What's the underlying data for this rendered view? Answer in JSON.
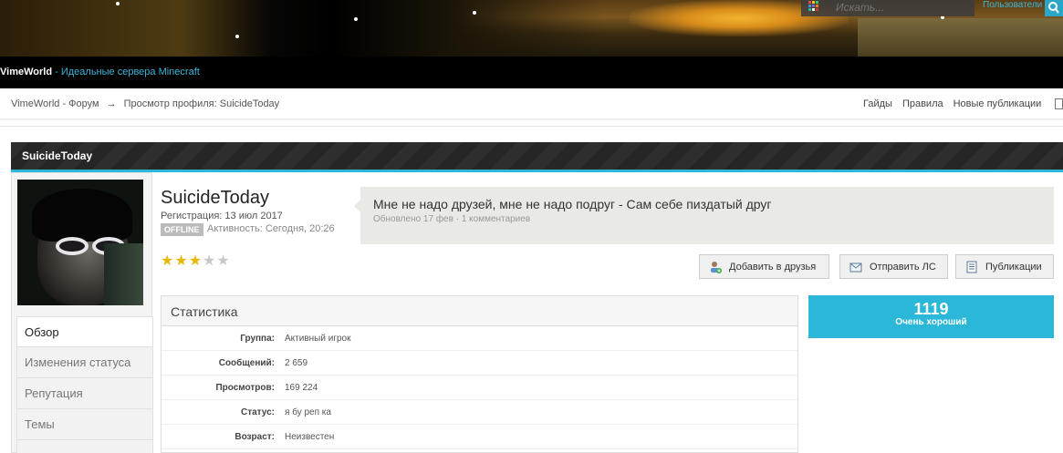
{
  "header": {
    "site_name": "VimeWorld",
    "tagline": " - Идеальные сервера Minecraft",
    "search_placeholder": "Искать...",
    "users_link": "Пользователи"
  },
  "breadcrumb": {
    "forum": "VimeWorld - Форум",
    "arrow": "→",
    "current": "Просмотр профиля: SuicideToday"
  },
  "nav": [
    "Гайды",
    "Правила",
    "Новые публикации"
  ],
  "profile": {
    "strip_title": "SuicideToday",
    "username": "SuicideToday",
    "registration": "Регистрация: 13 июл 2017",
    "offline_badge": "OFFLINE",
    "activity": "Активность: Сегодня, 20:26",
    "rating_stars": 3,
    "rating_max": 5
  },
  "status": {
    "text": "Мне не надо друзей, мне не надо подруг - Сам себе пиздатый друг",
    "meta": "Обновлено 17 фев · 1 комментариев"
  },
  "actions": {
    "add_friend": "Добавить в друзья",
    "send_pm": "Отправить ЛС",
    "publications": "Публикации"
  },
  "side_menu": [
    "Обзор",
    "Изменения статуса",
    "Репутация",
    "Темы"
  ],
  "stats": {
    "title": "Статистика",
    "rows": [
      {
        "k": "Группа:",
        "v": "Активный игрок"
      },
      {
        "k": "Сообщений:",
        "v": "2 659"
      },
      {
        "k": "Просмотров:",
        "v": "169 224"
      },
      {
        "k": "Статус:",
        "v": "я бу реп ка"
      },
      {
        "k": "Возраст:",
        "v": "Неизвестен"
      }
    ]
  },
  "reputation": {
    "value": "1119",
    "label": "Очень хороший"
  },
  "colors": {
    "accent": "#2ab7d8",
    "star_on": "#e6b800",
    "star_off": "#c8c8c8"
  }
}
